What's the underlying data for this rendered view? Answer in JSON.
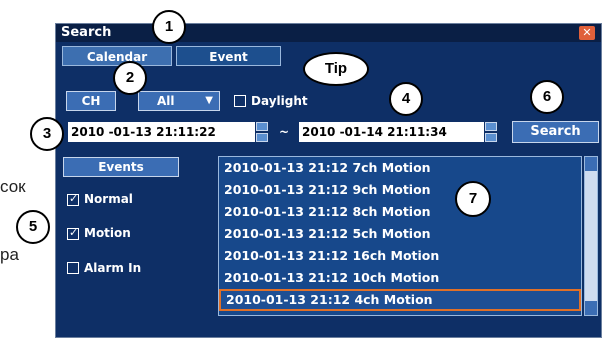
{
  "side_text": {
    "line1": "сок",
    "line2": "ра"
  },
  "window": {
    "title": "Search",
    "close_glyph": "✕",
    "tabs": [
      {
        "label": "Calendar",
        "active": false
      },
      {
        "label": "Event",
        "active": true
      }
    ]
  },
  "controls": {
    "ch_label": "CH",
    "channel_select": "All",
    "daylight_label": "Daylight",
    "start_datetime": "2010 -01-13 21:11:22",
    "range_separator": "~",
    "end_datetime": "2010 -01-14 21:11:34",
    "search_label": "Search"
  },
  "events_panel": {
    "header": "Events",
    "filters": [
      {
        "label": "Normal",
        "checked": true
      },
      {
        "label": "Motion",
        "checked": true
      },
      {
        "label": "Alarm In",
        "checked": false
      }
    ]
  },
  "results": [
    "2010-01-13 21:12 7ch Motion",
    "2010-01-13 21:12 9ch Motion",
    "2010-01-13 21:12 8ch Motion",
    "2010-01-13 21:12 5ch Motion",
    "2010-01-13 21:12 16ch Motion",
    "2010-01-13 21:12 10ch Motion",
    "2010-01-13 21:12 4ch Motion"
  ],
  "selected_result_index": 6,
  "callouts": {
    "c1": "1",
    "c2": "2",
    "c3": "3",
    "c4": "4",
    "c5": "5",
    "c6": "6",
    "c7": "7",
    "tip": "Tip"
  },
  "colors": {
    "window_bg": "#0e2f66",
    "button_bg": "#3b6db4",
    "selected_border": "#e07028",
    "close_button": "#e0603a"
  }
}
